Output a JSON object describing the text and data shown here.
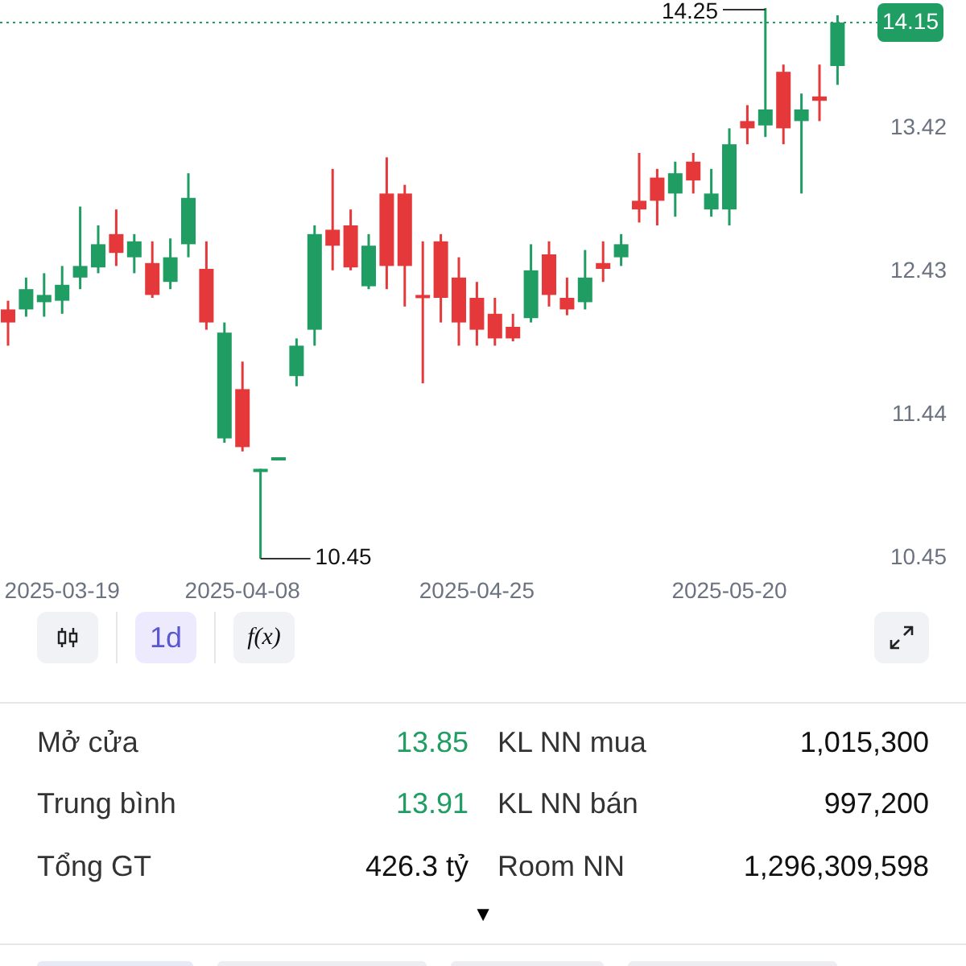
{
  "chart": {
    "chart_data": {
      "type": "candlestick",
      "categories": [
        null,
        null,
        null,
        "2025-03-19",
        null,
        null,
        null,
        null,
        null,
        null,
        null,
        null,
        null,
        "2025-04-08",
        null,
        null,
        null,
        null,
        null,
        null,
        null,
        null,
        null,
        null,
        null,
        null,
        "2025-04-25",
        null,
        null,
        null,
        null,
        null,
        null,
        null,
        null,
        null,
        null,
        null,
        null,
        null,
        "2025-05-20",
        null,
        null,
        null,
        null,
        null,
        null
      ],
      "ohlc": [
        [
          12.17,
          12.23,
          11.92,
          12.08
        ],
        [
          12.17,
          12.39,
          12.12,
          12.31
        ],
        [
          12.22,
          12.42,
          12.12,
          12.27
        ],
        [
          12.23,
          12.47,
          12.14,
          12.34
        ],
        [
          12.39,
          12.88,
          12.31,
          12.47
        ],
        [
          12.46,
          12.75,
          12.42,
          12.62
        ],
        [
          12.69,
          12.86,
          12.47,
          12.56
        ],
        [
          12.53,
          12.69,
          12.42,
          12.64
        ],
        [
          12.49,
          12.64,
          12.25,
          12.27
        ],
        [
          12.36,
          12.66,
          12.31,
          12.53
        ],
        [
          12.62,
          13.11,
          12.53,
          12.94
        ],
        [
          12.45,
          12.64,
          12.03,
          12.08
        ],
        [
          11.28,
          12.08,
          11.25,
          12.01
        ],
        [
          11.62,
          11.81,
          11.19,
          11.22
        ],
        [
          11.05,
          11.07,
          10.45,
          11.07
        ],
        [
          11.13,
          11.15,
          11.13,
          11.15
        ],
        [
          11.71,
          11.97,
          11.64,
          11.92
        ],
        [
          12.03,
          12.75,
          11.92,
          12.69
        ],
        [
          12.72,
          13.14,
          12.44,
          12.61
        ],
        [
          12.75,
          12.86,
          12.44,
          12.46
        ],
        [
          12.33,
          12.69,
          12.31,
          12.61
        ],
        [
          12.97,
          13.22,
          12.31,
          12.47
        ],
        [
          12.97,
          13.03,
          12.19,
          12.47
        ],
        [
          12.27,
          12.64,
          11.66,
          12.25
        ],
        [
          12.64,
          12.69,
          12.08,
          12.25
        ],
        [
          12.39,
          12.53,
          11.92,
          12.08
        ],
        [
          12.25,
          12.36,
          11.92,
          12.03
        ],
        [
          12.14,
          12.25,
          11.92,
          11.97
        ],
        [
          12.05,
          12.14,
          11.95,
          11.97
        ],
        [
          12.11,
          12.62,
          12.08,
          12.44
        ],
        [
          12.55,
          12.64,
          12.19,
          12.27
        ],
        [
          12.25,
          12.39,
          12.13,
          12.17
        ],
        [
          12.22,
          12.58,
          12.17,
          12.39
        ],
        [
          12.49,
          12.64,
          12.36,
          12.45
        ],
        [
          12.53,
          12.69,
          12.47,
          12.62
        ],
        [
          12.92,
          13.25,
          12.77,
          12.86
        ],
        [
          13.08,
          13.14,
          12.75,
          12.92
        ],
        [
          12.97,
          13.19,
          12.81,
          13.11
        ],
        [
          13.19,
          13.25,
          12.97,
          13.06
        ],
        [
          12.86,
          13.14,
          12.81,
          12.97
        ],
        [
          12.86,
          13.42,
          12.75,
          13.31
        ],
        [
          13.47,
          13.58,
          13.31,
          13.42
        ],
        [
          13.44,
          14.25,
          13.36,
          13.55
        ],
        [
          13.81,
          13.86,
          13.31,
          13.42
        ],
        [
          13.47,
          13.66,
          12.97,
          13.55
        ],
        [
          13.64,
          13.86,
          13.47,
          13.61
        ],
        [
          13.85,
          14.2,
          13.72,
          14.15
        ]
      ],
      "ylim": [
        10.45,
        13.42
      ],
      "yticks": [
        13.42,
        12.43,
        11.44,
        10.45
      ]
    },
    "high_label": "14.25",
    "low_label": "10.45",
    "last_price": "14.15"
  },
  "toolbar": [
    {
      "kind": "candles"
    },
    {
      "kind": "interval",
      "label": "1d"
    },
    {
      "kind": "function",
      "label": "f(x)"
    }
  ],
  "stats": [
    {
      "label": "Mở cửa",
      "value": "13.85",
      "color": "#1f9d63"
    },
    {
      "label": "KL NN mua",
      "value": "1,015,300",
      "color": "#111111"
    },
    {
      "label": "Trung bình",
      "value": "13.91",
      "color": "#1f9d63"
    },
    {
      "label": "KL NN bán",
      "value": "997,200",
      "color": "#111111"
    },
    {
      "label": "Tổng GT",
      "value": "426.3 tỷ",
      "color": "#111111"
    },
    {
      "label": "Room NN",
      "value": "1,296,309,598",
      "color": "#111111"
    }
  ],
  "more_toggle": "▼"
}
